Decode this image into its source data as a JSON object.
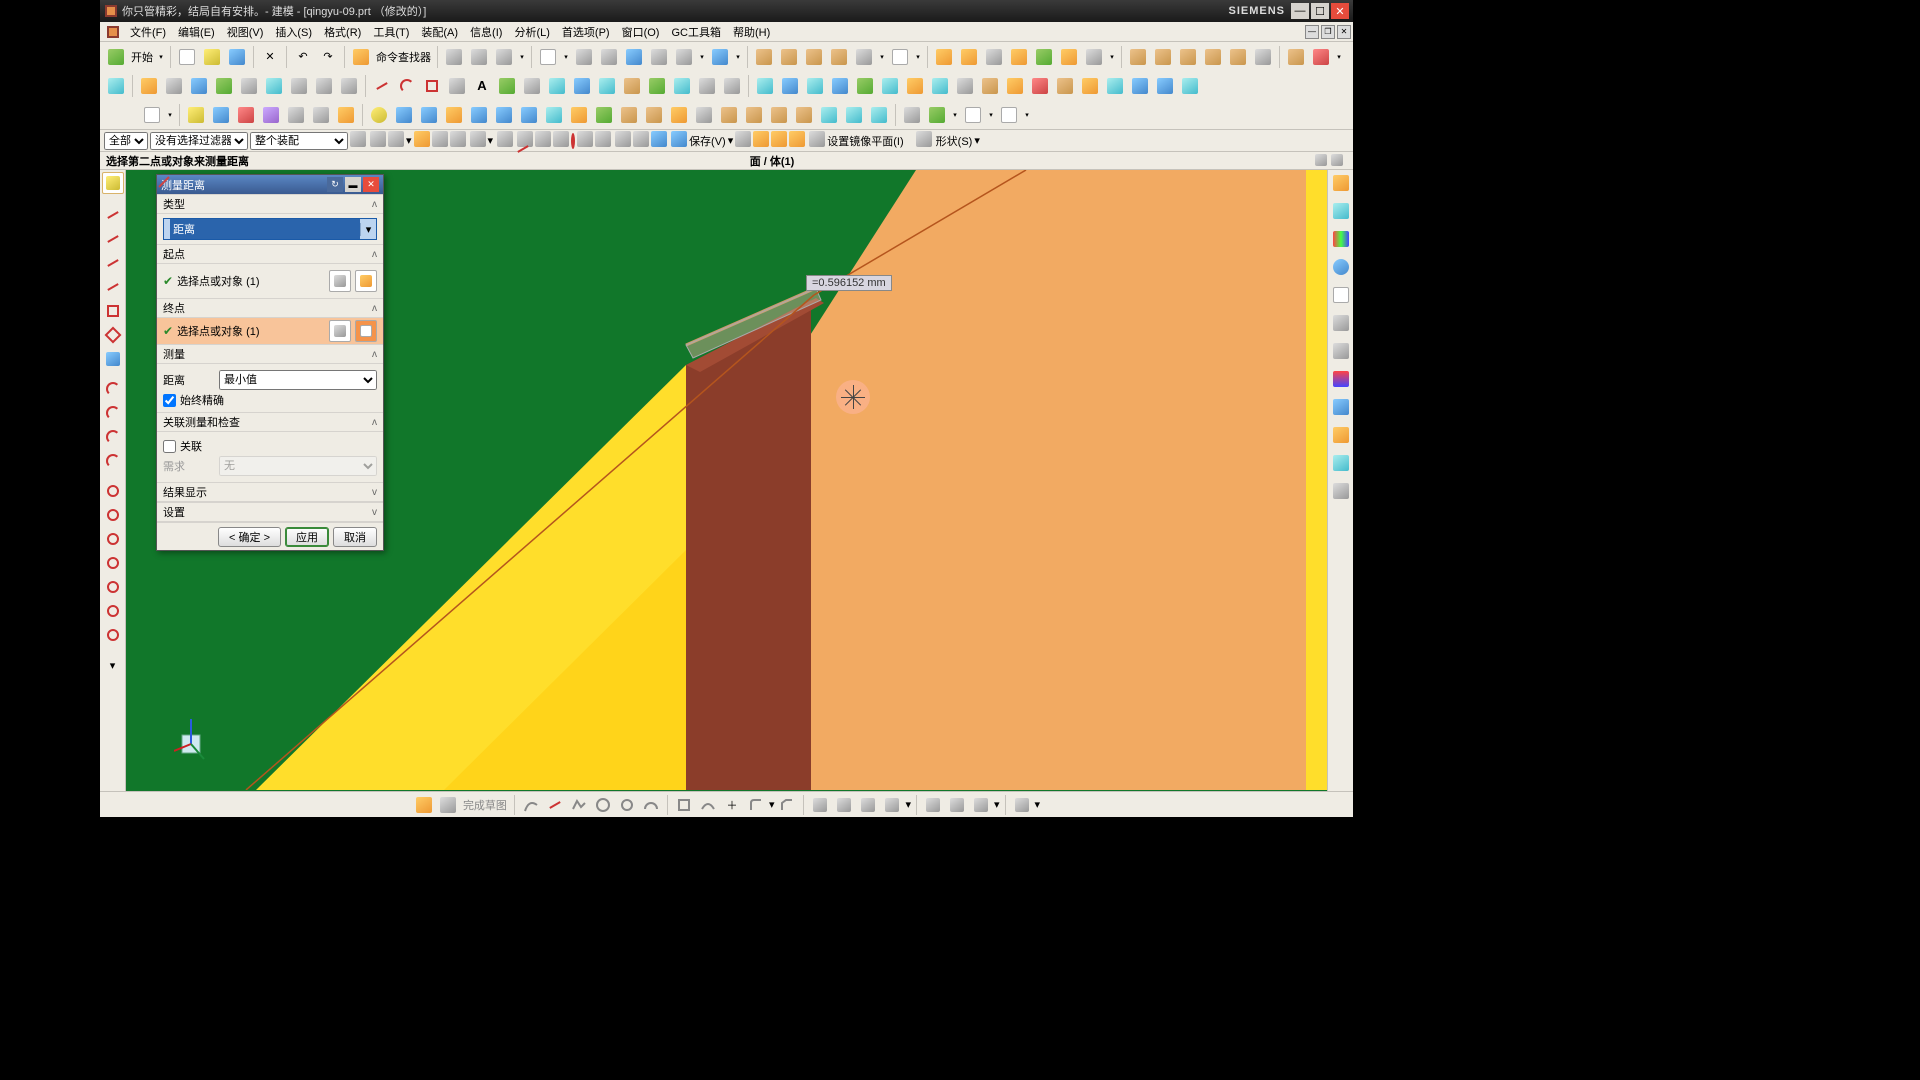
{
  "title": "你只管精彩，结局自有安排。- 建模 - [qingyu-09.prt （修改的）]",
  "brand": "SIEMENS",
  "menu": [
    "文件(F)",
    "编辑(E)",
    "视图(V)",
    "插入(S)",
    "格式(R)",
    "工具(T)",
    "装配(A)",
    "信息(I)",
    "分析(L)",
    "首选项(P)",
    "窗口(O)",
    "GC工具箱",
    "帮助(H)"
  ],
  "start_label": "开始",
  "cmd_finder_label": "命令查找器",
  "filterbar": {
    "scope": "全部",
    "filter": "没有选择过滤器",
    "assembly": "整个装配",
    "save_label": "保存(V)",
    "mirror_label": "设置镜像平面(I)",
    "shape_label": "形状(S)"
  },
  "prompt": {
    "left": "选择第二点或对象来测量距离",
    "center": "面 / 体(1)"
  },
  "dialog": {
    "title": "测量距离",
    "sections": {
      "type": "类型",
      "type_value": "距离",
      "start": "起点",
      "start_obj": "选择点或对象 (1)",
      "end": "终点",
      "end_obj": "选择点或对象 (1)",
      "measure": "测量",
      "distance_label": "距离",
      "distance_mode": "最小值",
      "always_exact": "始终精确",
      "assoc": "关联测量和检查",
      "assoc_chk": "关联",
      "assoc_req_label": "需求",
      "assoc_req_value": "无",
      "results": "结果显示",
      "settings": "设置"
    },
    "ok": "< 确定 >",
    "apply": "应用",
    "cancel": "取消"
  },
  "measurement": "=0.596152 mm",
  "bottombar_label": "完成草图"
}
